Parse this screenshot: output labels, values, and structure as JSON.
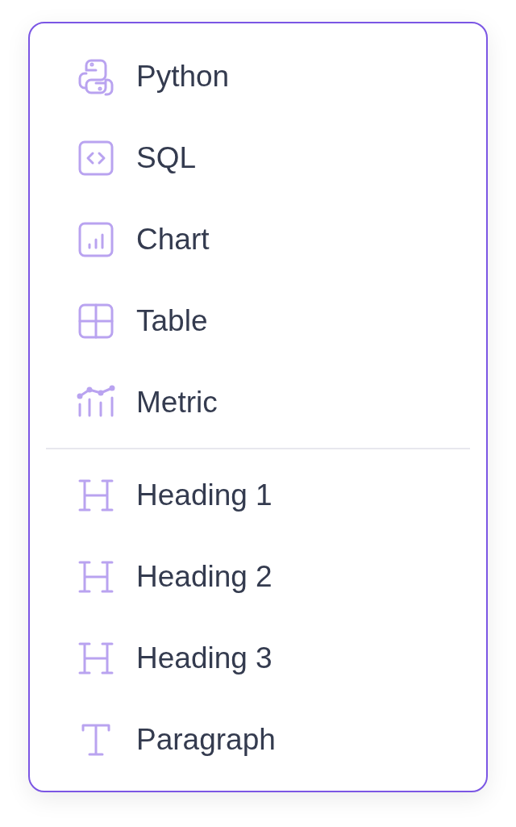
{
  "menu": {
    "groups": [
      {
        "items": [
          {
            "label": "Python",
            "kind": "python"
          },
          {
            "label": "SQL",
            "kind": "code"
          },
          {
            "label": "Chart",
            "kind": "chart"
          },
          {
            "label": "Table",
            "kind": "table"
          },
          {
            "label": "Metric",
            "kind": "metric"
          }
        ]
      },
      {
        "items": [
          {
            "label": "Heading 1",
            "kind": "heading"
          },
          {
            "label": "Heading 2",
            "kind": "heading"
          },
          {
            "label": "Heading 3",
            "kind": "heading"
          },
          {
            "label": "Paragraph",
            "kind": "paragraph"
          }
        ]
      }
    ]
  }
}
